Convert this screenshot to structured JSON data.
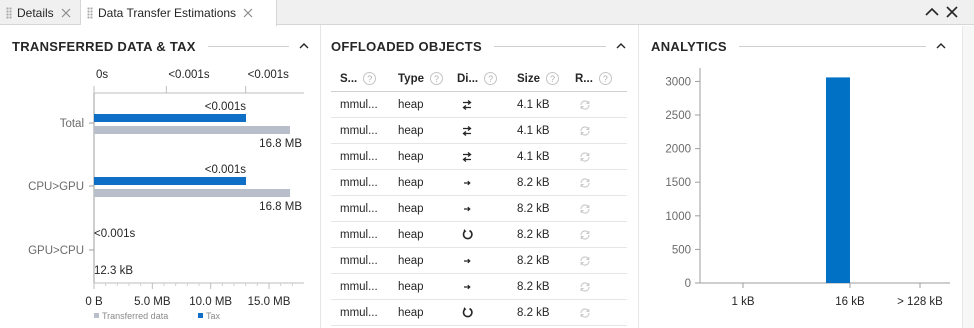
{
  "tabs": [
    {
      "label": "Details"
    },
    {
      "label": "Data Transfer Estimations"
    }
  ],
  "panels": {
    "transferred": {
      "title": "TRANSFERRED DATA & TAX"
    },
    "offloaded": {
      "title": "OFFLOADED OBJECTS"
    },
    "analytics": {
      "title": "ANALYTICS"
    }
  },
  "colors": {
    "tax": "#0f6fc6",
    "transferred": "#b8bfca",
    "accent": "#0071c5"
  },
  "transfer_chart": {
    "type": "bar",
    "categories": [
      "Total",
      "CPU>GPU",
      "GPU>CPU"
    ],
    "top_ticks": [
      "0s",
      "<0.001s",
      "<0.001s"
    ],
    "bottom_ticks": [
      "0 B",
      "5.0 MB",
      "10.0 MB",
      "15.0 MB"
    ],
    "xlim_mb": [
      0,
      18
    ],
    "series": [
      {
        "name": "Tax",
        "values_s": [
          0.0005,
          0.0005,
          0.0
        ],
        "labels": [
          "<0.001s",
          "<0.001s",
          "<0.001s"
        ]
      },
      {
        "name": "Transferred data",
        "values_mb": [
          16.8,
          16.8,
          0.0123
        ],
        "labels": [
          "16.8 MB",
          "16.8 MB",
          "12.3 kB"
        ]
      }
    ],
    "legend": [
      {
        "name": "Transferred data",
        "color": "transferred"
      },
      {
        "name": "Tax",
        "color": "tax"
      }
    ]
  },
  "table": {
    "headers": [
      "S...",
      "Type",
      "Di...",
      "Size",
      "R..."
    ],
    "rows": [
      {
        "name": "mmul...",
        "type": "heap",
        "dir": "bidirectional",
        "size": "4.1 kB"
      },
      {
        "name": "mmul...",
        "type": "heap",
        "dir": "bidirectional",
        "size": "4.1 kB"
      },
      {
        "name": "mmul...",
        "type": "heap",
        "dir": "bidirectional",
        "size": "4.1 kB"
      },
      {
        "name": "mmul...",
        "type": "heap",
        "dir": "to-gpu",
        "size": "8.2 kB"
      },
      {
        "name": "mmul...",
        "type": "heap",
        "dir": "to-gpu",
        "size": "8.2 kB"
      },
      {
        "name": "mmul...",
        "type": "heap",
        "dir": "round-trip",
        "size": "8.2 kB"
      },
      {
        "name": "mmul...",
        "type": "heap",
        "dir": "to-gpu",
        "size": "8.2 kB"
      },
      {
        "name": "mmul...",
        "type": "heap",
        "dir": "to-gpu",
        "size": "8.2 kB"
      },
      {
        "name": "mmul...",
        "type": "heap",
        "dir": "round-trip",
        "size": "8.2 kB"
      }
    ]
  },
  "chart_data": {
    "type": "bar",
    "title": "ANALYTICS",
    "categories": [
      "1 kB",
      "16 kB",
      "> 128 kB"
    ],
    "bins": [
      "1 kB",
      "",
      "",
      "16 kB",
      "",
      "> 128 kB"
    ],
    "values": [
      0,
      0,
      0,
      3060,
      0,
      0
    ],
    "yticks": [
      0,
      500,
      1000,
      1500,
      2000,
      2500,
      3000
    ],
    "ylim": [
      0,
      3200
    ],
    "grid": false
  }
}
